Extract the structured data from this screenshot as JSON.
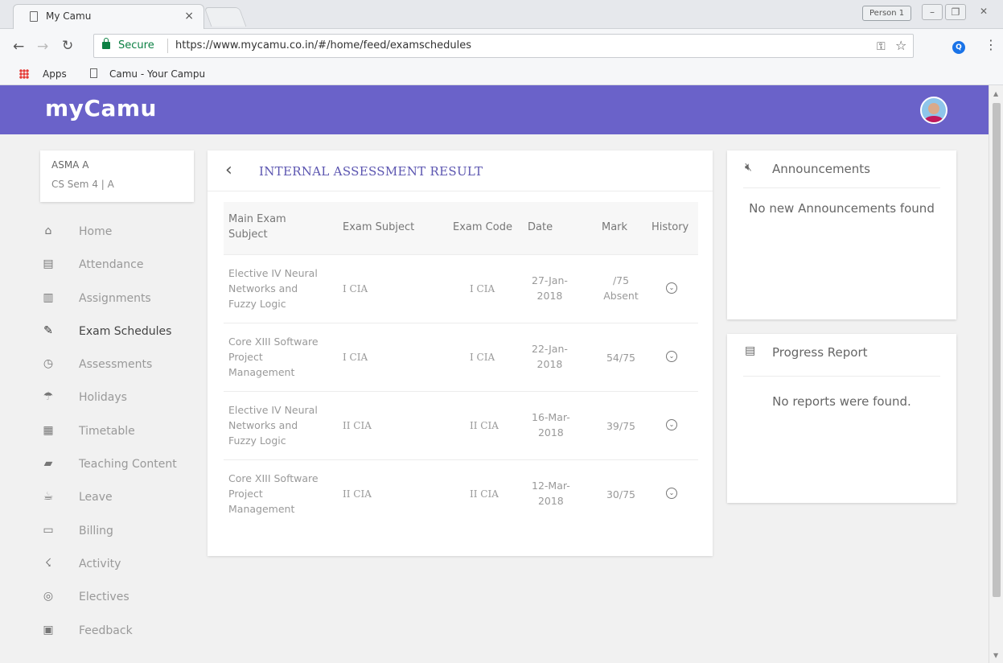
{
  "browser": {
    "tab_title": "My Camu",
    "tab_close": "×",
    "profile": "Person 1",
    "secure_label": "Secure",
    "url": "https://www.mycamu.co.in/#/home/feed/examschedules",
    "bookmarks": [
      {
        "label": "Apps"
      },
      {
        "label": "Camu - Your Campu"
      }
    ]
  },
  "app": {
    "brand": "myCamu",
    "user": {
      "name": "ASMA A",
      "sem": "CS Sem 4  | A"
    },
    "nav": [
      {
        "label": "Home",
        "icon": "home-icon",
        "glyph": "⌂"
      },
      {
        "label": "Attendance",
        "icon": "attendance-icon",
        "glyph": "▤"
      },
      {
        "label": "Assignments",
        "icon": "assignments-icon",
        "glyph": "▥"
      },
      {
        "label": "Exam Schedules",
        "icon": "exam-schedules-icon",
        "glyph": "✎",
        "active": true
      },
      {
        "label": "Assessments",
        "icon": "stopwatch-icon",
        "glyph": "◷"
      },
      {
        "label": "Holidays",
        "icon": "beach-umbrella-icon",
        "glyph": "☂"
      },
      {
        "label": "Timetable",
        "icon": "calendar-icon",
        "glyph": "▦"
      },
      {
        "label": "Teaching Content",
        "icon": "book-icon",
        "glyph": "▰"
      },
      {
        "label": "Leave",
        "icon": "leave-icon",
        "glyph": "☕"
      },
      {
        "label": "Billing",
        "icon": "billing-icon",
        "glyph": "▭"
      },
      {
        "label": "Activity",
        "icon": "running-icon",
        "glyph": "☇"
      },
      {
        "label": "Electives",
        "icon": "target-icon",
        "glyph": "◎"
      },
      {
        "label": "Feedback",
        "icon": "feedback-icon",
        "glyph": "▣"
      }
    ],
    "main": {
      "title": "INTERNAL ASSESSMENT RESULT",
      "columns": [
        "Main Exam Subject",
        "Exam Subject",
        "Exam Code",
        "Date",
        "Mark",
        "History"
      ],
      "rows": [
        {
          "main": [
            "Elective IV Neural",
            "Networks and",
            "Fuzzy Logic"
          ],
          "subject": "I CIA",
          "code": "I CIA",
          "date": [
            "27-Jan-",
            "2018"
          ],
          "mark": [
            "/75",
            "Absent"
          ]
        },
        {
          "main": [
            "Core XIII Software",
            "Project",
            "Management"
          ],
          "subject": "I CIA",
          "code": "I CIA",
          "date": [
            "22-Jan-",
            "2018"
          ],
          "mark": [
            "54/75"
          ]
        },
        {
          "main": [
            "Elective IV Neural",
            "Networks and",
            "Fuzzy Logic"
          ],
          "subject": "II CIA",
          "code": "II CIA",
          "date": [
            "16-Mar-",
            "2018"
          ],
          "mark": [
            "39/75"
          ]
        },
        {
          "main": [
            "Core XIII Software",
            "Project",
            "Management"
          ],
          "subject": "II CIA",
          "code": "II CIA",
          "date": [
            "12-Mar-",
            "2018"
          ],
          "mark": [
            "30/75"
          ]
        }
      ]
    },
    "announcements": {
      "title": "Announcements",
      "empty": "No new Announcements found"
    },
    "progress": {
      "title": "Progress Report",
      "empty": "No reports were found."
    }
  },
  "colors": {
    "header": "#6a62c9",
    "title_accent": "#5b55b0",
    "secure": "#0b8043"
  }
}
